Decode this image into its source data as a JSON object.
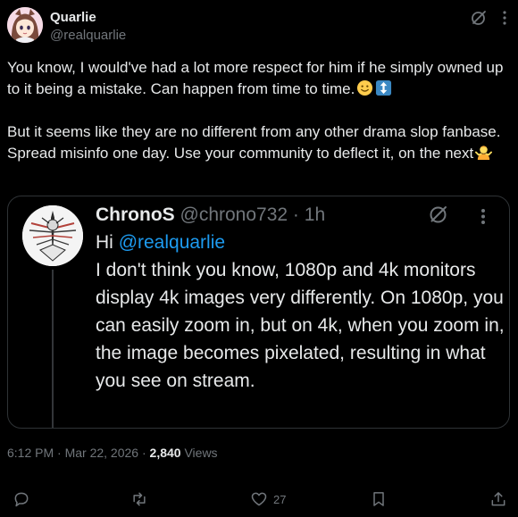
{
  "author": {
    "display_name": "Quarlie",
    "handle": "@realquarlie",
    "avatar_icon": "anime-avatar-icon"
  },
  "post": {
    "paragraph_1": "You know, I would've had a lot more respect for him if he simply owned up to it being a mistake. Can happen from time to time.",
    "paragraph_1_emojis": [
      "slightly-smiling-face-emoji",
      "up-down-arrow-emoji"
    ],
    "paragraph_2": "But it seems like they are no different from any other drama slop fanbase. Spread misinfo one day. Use your community to deflect it, on the next",
    "paragraph_2_emoji": "person-shrugging-emoji"
  },
  "quoted_post": {
    "display_name": "ChronoS",
    "handle": "@chrono732",
    "separator": "·",
    "time": "1h",
    "greeting": "Hi",
    "mention": "@realquarlie",
    "text": "I don't think you know, 1080p and 4k monitors display 4k images very differently. On 1080p, you can easily zoom in, but on 4k, when you zoom in, the image becomes pixelated, resulting in what you see on stream."
  },
  "meta": {
    "timestamp": "6:12 PM · Mar 22, 2026 ·",
    "views_count": "2,840",
    "views_label": "Views"
  },
  "actions": {
    "reply_count": "",
    "repost_count": "",
    "like_count": "27",
    "bookmark_count": ""
  },
  "colors": {
    "background": "#000000",
    "text": "#e7e9ea",
    "secondary": "#71767b",
    "link": "#1d9bf0",
    "border": "#2f3336"
  }
}
